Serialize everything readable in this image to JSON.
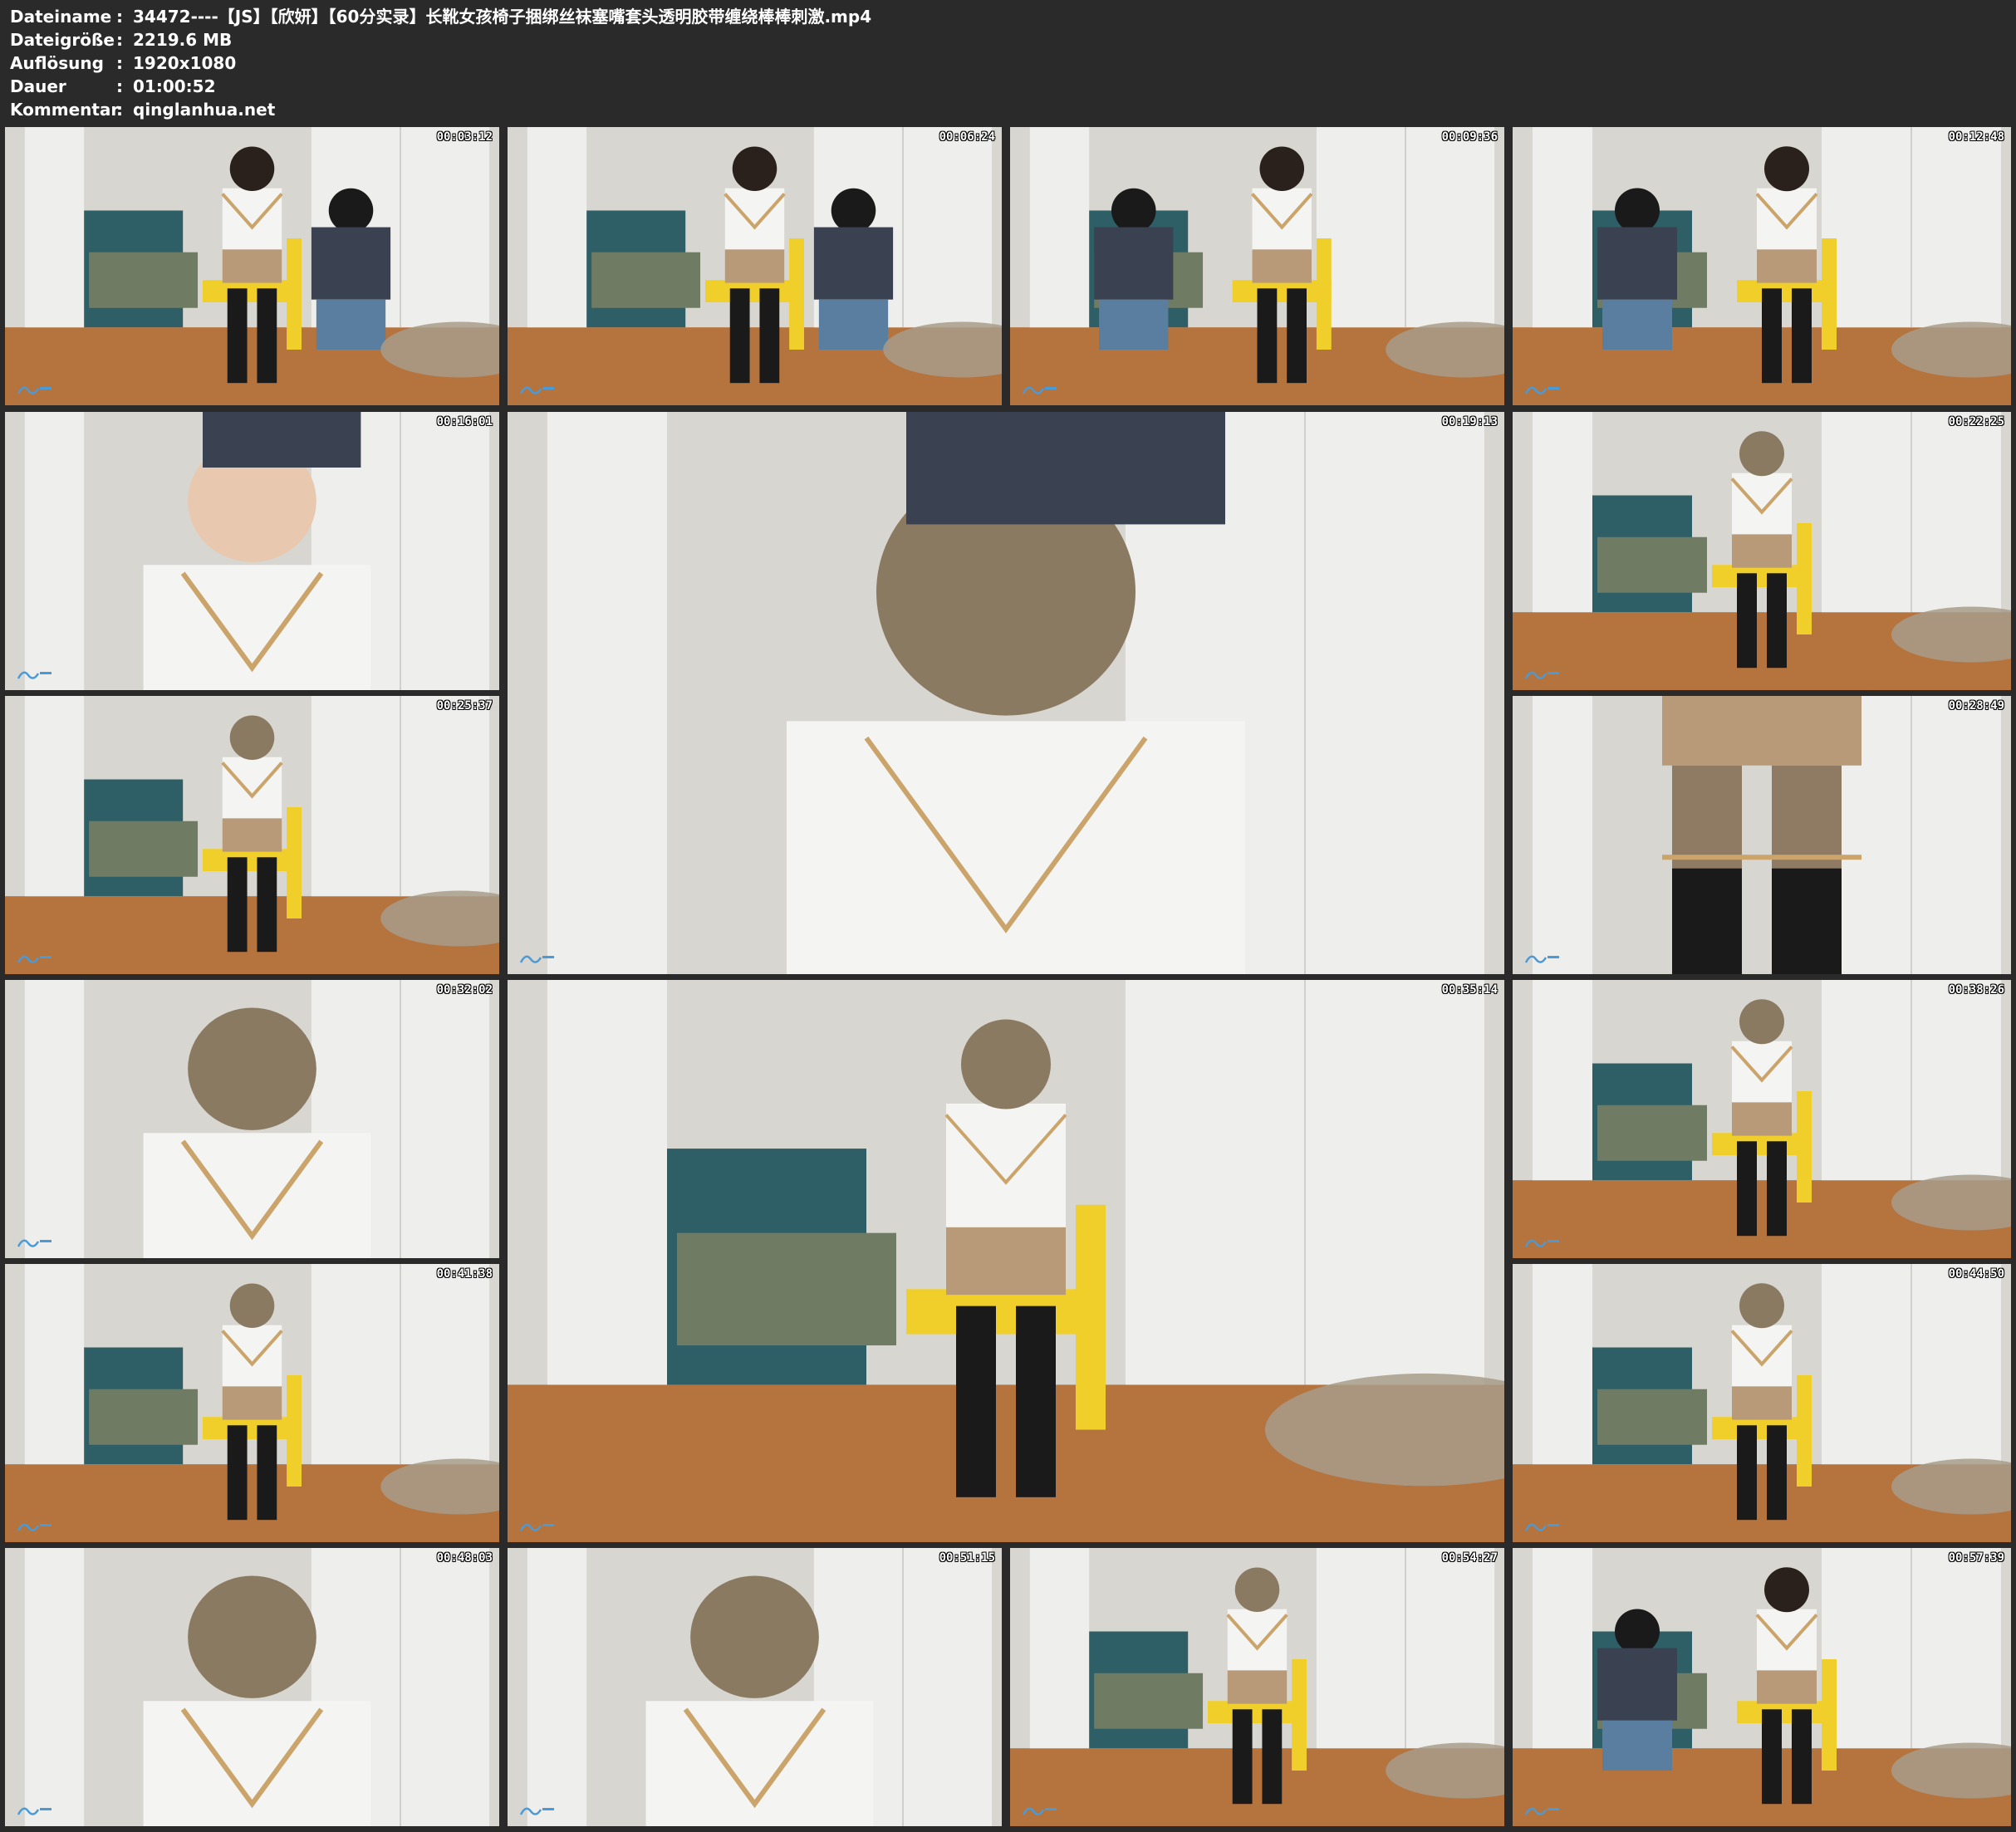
{
  "header": {
    "rows": [
      {
        "key": "Dateiname",
        "value": "34472----【JS】【欣妍】【60分实录】长靴女孩椅子捆绑丝袜塞嘴套头透明胶带缠绕棒棒刺激.mp4"
      },
      {
        "key": "Dateigröße",
        "value": "2219.6 MB"
      },
      {
        "key": "Auflösung",
        "value": "1920x1080"
      },
      {
        "key": "Dauer",
        "value": "01:00:52"
      },
      {
        "key": "Kommentar",
        "value": "qinglanhua.net"
      }
    ],
    "separator": ":"
  },
  "thumbnails": [
    {
      "timestamp": "00:03:12",
      "scene": "standing-pair"
    },
    {
      "timestamp": "00:06:24",
      "scene": "seated-standing-man"
    },
    {
      "timestamp": "00:09:36",
      "scene": "seated-kneeling-man"
    },
    {
      "timestamp": "00:12:48",
      "scene": "seated-kneeling-man"
    },
    {
      "timestamp": "00:16:01",
      "scene": "closeup-hand"
    },
    {
      "timestamp": "00:19:13",
      "scene": "closeup-hood"
    },
    {
      "timestamp": "00:22:25",
      "scene": "seated-hood"
    },
    {
      "timestamp": "00:25:37",
      "scene": "seated-hood"
    },
    {
      "timestamp": "00:28:49",
      "scene": "legs-closeup"
    },
    {
      "timestamp": "00:32:02",
      "scene": "upper-closeup"
    },
    {
      "timestamp": "00:35:14",
      "scene": "seated-hood-wide"
    },
    {
      "timestamp": "00:38:26",
      "scene": "seated-hood"
    },
    {
      "timestamp": "00:41:38",
      "scene": "seated-hood-mid"
    },
    {
      "timestamp": "00:44:50",
      "scene": "seated-hood-mid"
    },
    {
      "timestamp": "00:48:03",
      "scene": "upper-closeup"
    },
    {
      "timestamp": "00:51:15",
      "scene": "upper-closeup"
    },
    {
      "timestamp": "00:54:27",
      "scene": "seated-hood"
    },
    {
      "timestamp": "00:57:39",
      "scene": "seated-kneeling-man"
    }
  ],
  "colors": {
    "background": "#2a2a2a",
    "header_text": "#ffffff",
    "wall": "#d8d6d0",
    "door": "#eeeeec",
    "floor": "#b5733e",
    "shirt": "#f4f4f2",
    "skirt": "#b89a78",
    "boots": "#1a1a1a",
    "chair": "#f0cf2a",
    "man_shirt": "#3a4150",
    "rope": "#caa46a",
    "hood": "#8a7a62"
  }
}
